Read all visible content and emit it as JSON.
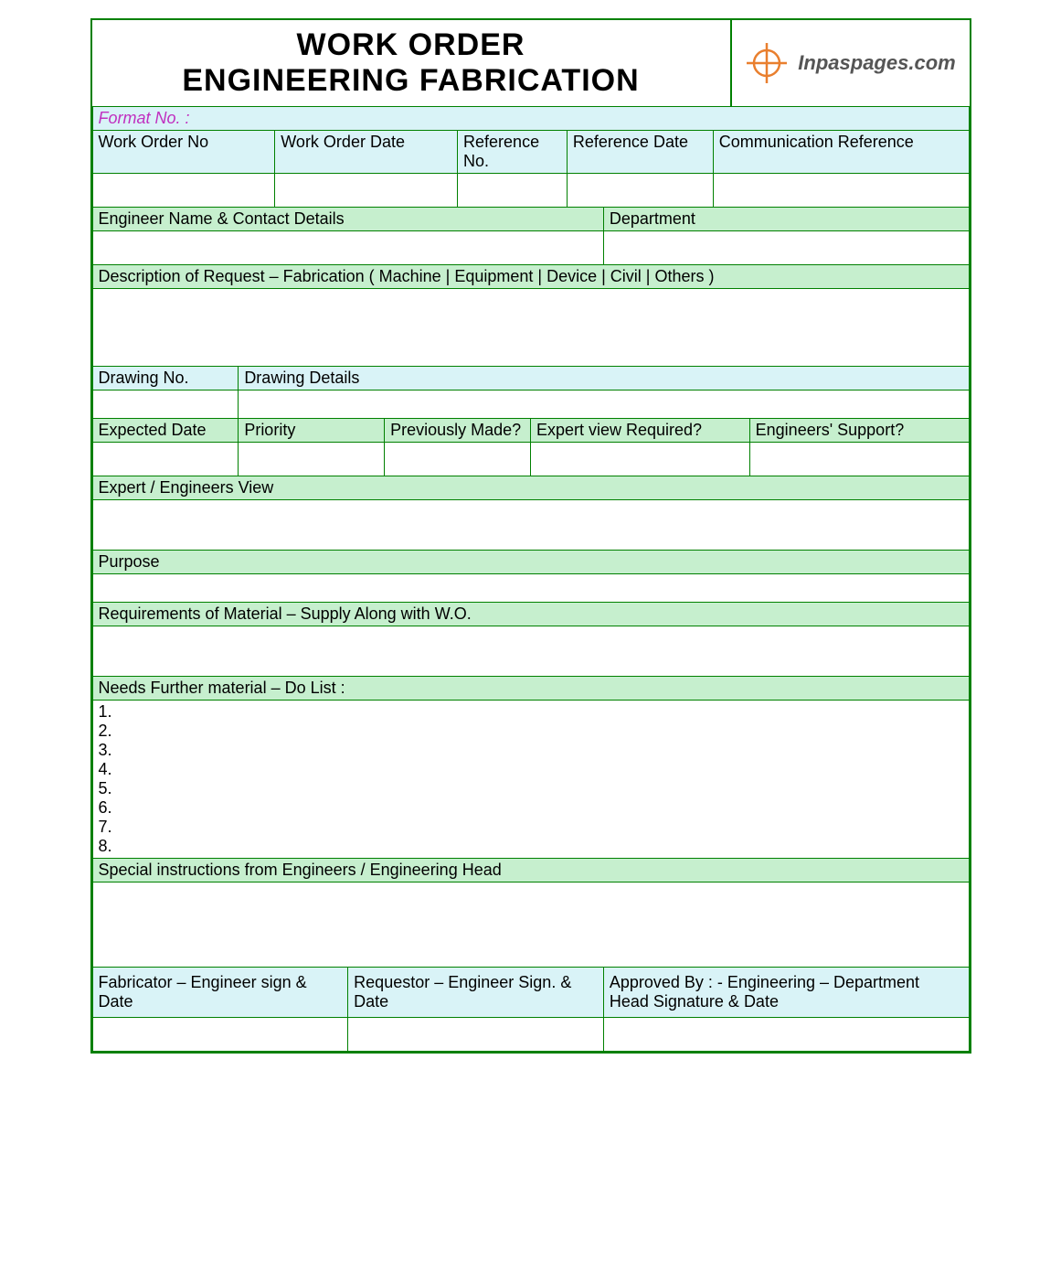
{
  "title_line1": "WORK ORDER",
  "title_line2": "ENGINEERING FABRICATION",
  "logo_text": "Inpaspages.com",
  "format_no_label": "Format No. :",
  "row1": {
    "work_order_no": "Work Order No",
    "work_order_date": "Work Order Date",
    "reference_no": "Reference No.",
    "reference_date": "Reference Date",
    "comm_ref": "Communication Reference"
  },
  "row2": {
    "engineer": "Engineer Name & Contact Details",
    "department": "Department"
  },
  "desc_label": "Description of Request – Fabrication ( Machine | Equipment | Device | Civil | Others )",
  "drawing_no": "Drawing No.",
  "drawing_details": "Drawing Details",
  "row5": {
    "expected_date": "Expected Date",
    "priority": "Priority",
    "prev_made": "Previously Made?",
    "expert_req": "Expert view Required?",
    "eng_support": "Engineers' Support?"
  },
  "expert_view": "Expert / Engineers View",
  "purpose": "Purpose",
  "req_material": "Requirements of Material – Supply Along with W.O.",
  "do_list_label": "Needs Further material – Do List :",
  "do_list": [
    "1.",
    "2.",
    "3.",
    "4.",
    "5.",
    "6.",
    "7.",
    "8."
  ],
  "special_instr": "Special instructions from Engineers / Engineering Head",
  "sig": {
    "fabricator": "Fabricator – Engineer sign & Date",
    "requestor": "Requestor – Engineer Sign. & Date",
    "approved": "Approved By : - Engineering – Department Head Signature & Date"
  }
}
